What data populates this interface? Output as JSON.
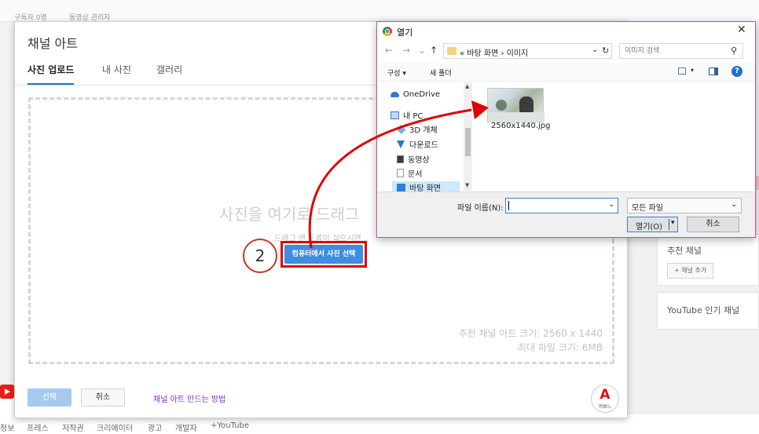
{
  "background": {
    "top_left_text": "구독자 0명",
    "top_video_manager": "동영상 관리자",
    "right_card1_title": "추천 채널",
    "right_card1_chip": "+ 채널 추가",
    "right_card2_title": "YouTube 인기 채널",
    "footer": [
      "정보",
      "프레스",
      "저작권",
      "크리에이터",
      "광고",
      "개발자",
      "+YouTube"
    ]
  },
  "dialog": {
    "title": "채널 아트",
    "tabs": [
      "사진 업로드",
      "내 사진",
      "갤러리"
    ],
    "drop_big": "사진을 여기로 드래그",
    "drop_small": "드래그 앤 드롭이 싫으시면...",
    "select_from_computer": "컴퓨터에서 사진 선택",
    "step_number": "2",
    "recommended_size": "추천 채널 아트 크기: 2560 x 1440",
    "max_file_size": "최대 파일 크기: 6MB",
    "select_button": "선택",
    "cancel_button": "취소",
    "how_to_link": "채널 아트 만드는 방법",
    "brand_mark": "A",
    "brand_text": "아보느"
  },
  "file_dialog": {
    "title": "열기",
    "close": "✕",
    "back": "←",
    "forward": "→",
    "recent": "⌄",
    "up": "↑",
    "address_path": "« 바탕 화면  ›  이미지",
    "search_placeholder": "이미지 검색",
    "toolbar": {
      "organize": "구성 ▾",
      "new_folder": "새 폴더",
      "help": "?"
    },
    "nav_items": [
      {
        "label": "OneDrive",
        "icon": "cloud-icon"
      },
      {
        "label": "내 PC",
        "icon": "computer-icon"
      },
      {
        "label": "3D 개체",
        "icon": "cube-icon"
      },
      {
        "label": "다운로드",
        "icon": "download-icon"
      },
      {
        "label": "동영상",
        "icon": "video-icon"
      },
      {
        "label": "문서",
        "icon": "document-icon"
      },
      {
        "label": "바탕 화면",
        "icon": "desktop-icon"
      }
    ],
    "file": {
      "name": "2560x1440.jpg",
      "icon": "image-thumbnail"
    },
    "filename_label": "파일 이름(N):",
    "filename_value": "",
    "filter_value": "모든 파일",
    "open_button": "열기(O)",
    "cancel_button": "취소"
  },
  "colors": {
    "accent_blue": "#3d8de3",
    "highlight_red": "#e00000",
    "link_purple": "#7b2ed1",
    "dialog_border": "#d04a9a"
  }
}
